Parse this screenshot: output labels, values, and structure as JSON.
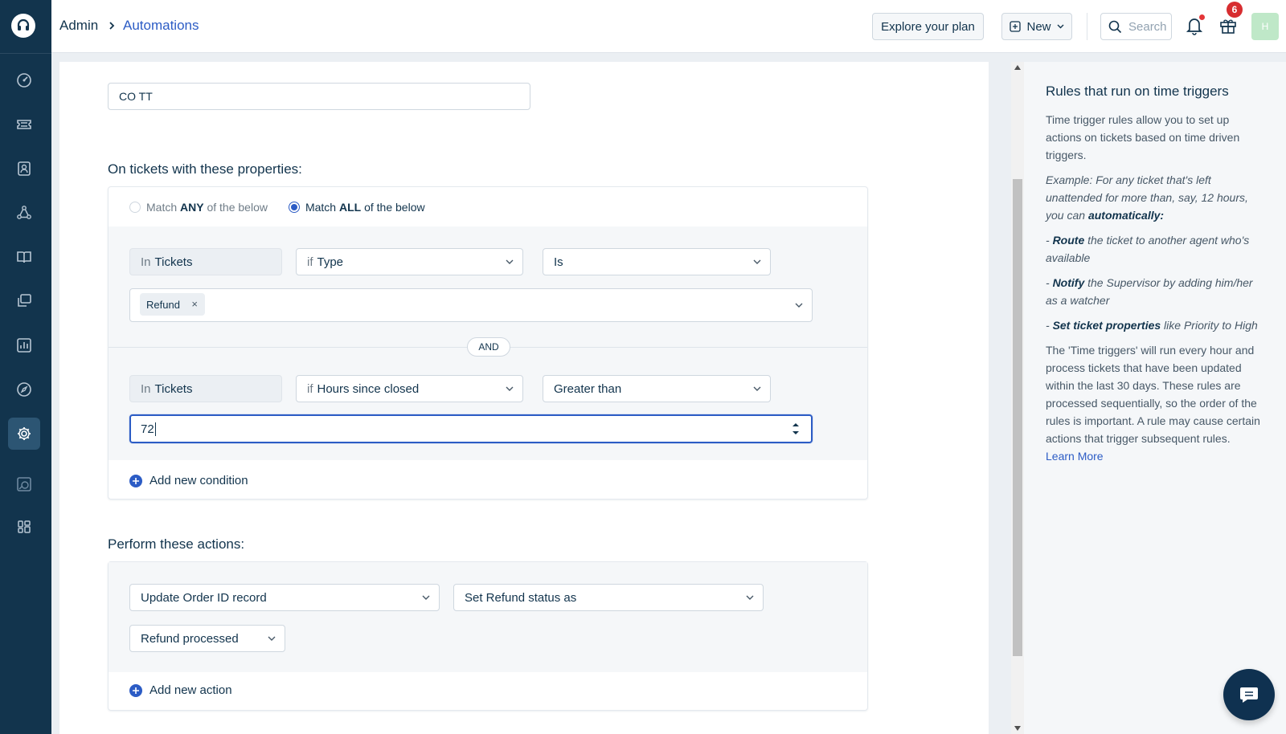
{
  "header": {
    "breadcrumb_root": "Admin",
    "breadcrumb_current": "Automations",
    "explore_plan_label": "Explore your plan",
    "new_label": "New",
    "search_placeholder": "Search",
    "gift_badge_count": "6",
    "avatar_initial": "H"
  },
  "sidebar": {
    "items": [
      {
        "icon": "dashboard-icon"
      },
      {
        "icon": "tickets-icon"
      },
      {
        "icon": "contacts-icon"
      },
      {
        "icon": "groups-icon"
      },
      {
        "icon": "knowledge-base-icon"
      },
      {
        "icon": "forums-icon"
      },
      {
        "icon": "reports-icon"
      },
      {
        "icon": "discover-icon"
      },
      {
        "icon": "admin-settings-icon",
        "active": true
      },
      {
        "icon": "freshworks-icon"
      },
      {
        "icon": "apps-icon"
      }
    ]
  },
  "rule": {
    "name_value": "CO TT",
    "conditions_title": "On tickets with these properties:",
    "match_any_prefix": "Match ",
    "match_any_bold": "ANY",
    "match_any_suffix": " of the below",
    "match_all_prefix": "Match ",
    "match_all_bold": "ALL",
    "match_all_suffix": " of the below",
    "match_selected": "ALL",
    "conditions": [
      {
        "scope_prefix": "In",
        "scope": "Tickets",
        "field_prefix": "if",
        "field": "Type",
        "operator": "Is",
        "value_tag": "Refund"
      },
      {
        "scope_prefix": "In",
        "scope": "Tickets",
        "field_prefix": "if",
        "field": "Hours since closed",
        "operator": "Greater than",
        "value": "72"
      }
    ],
    "and_label": "AND",
    "add_condition_label": "Add new condition",
    "actions_title": "Perform these actions:",
    "actions": [
      {
        "target": "Update Order ID record",
        "property": "Set Refund status as",
        "value": "Refund processed"
      }
    ],
    "add_action_label": "Add new action"
  },
  "help": {
    "title": "Rules that run on time triggers",
    "intro": "Time trigger rules allow you to set up actions on tickets based on time driven triggers.",
    "example_text": "Example: For any ticket that's left unattended for more than, say, 12 hours, you can ",
    "example_bold": "automatically:",
    "bullet1_dash": "- ",
    "bullet1_bold": "Route",
    "bullet1_text": " the ticket to another agent who's available",
    "bullet2_dash": "- ",
    "bullet2_bold": "Notify",
    "bullet2_text": " the Supervisor by adding him/her as a watcher",
    "bullet3_dash": "- ",
    "bullet3_bold": "Set ticket properties",
    "bullet3_text": " like Priority to High",
    "body": "The 'Time triggers' will run every hour and process tickets that have been updated within the last 30 days. These rules are processed sequentially, so the order of the rules is important. A rule may cause certain actions that trigger subsequent rules.",
    "learn_more": "Learn More"
  },
  "colors": {
    "sidebar_bg": "#12344d",
    "accent": "#2c5cc5",
    "badge": "#d72d30"
  }
}
